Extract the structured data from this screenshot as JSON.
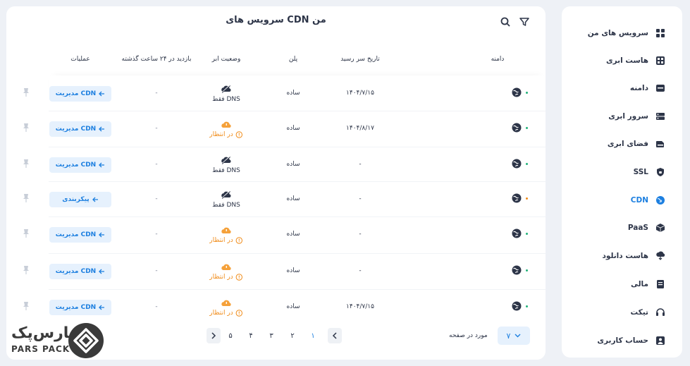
{
  "sidebar": {
    "items": [
      {
        "label": "سرویس های من",
        "icon": "grid-icon",
        "active": false
      },
      {
        "label": "هاست ابری",
        "icon": "host-icon",
        "active": false
      },
      {
        "label": "دامنه",
        "icon": "domain-icon",
        "active": false
      },
      {
        "label": "سرور ابری",
        "icon": "server-icon",
        "active": false
      },
      {
        "label": "فضای ابری",
        "icon": "storage-icon",
        "active": false
      },
      {
        "label": "SSL",
        "icon": "shield-icon",
        "active": false
      },
      {
        "label": "CDN",
        "icon": "globe-icon",
        "active": true
      },
      {
        "label": "PaaS",
        "icon": "box-icon",
        "active": false
      },
      {
        "label": "هاست دانلود",
        "icon": "cloud-download-icon",
        "active": false
      },
      {
        "label": "مالی",
        "icon": "invoice-icon",
        "active": false
      },
      {
        "label": "تیکت",
        "icon": "headset-icon",
        "active": false
      },
      {
        "label": "حساب کاربری",
        "icon": "user-icon",
        "active": false
      }
    ]
  },
  "main": {
    "title": "سرویس های CDN من",
    "columns": {
      "domain": "دامنه",
      "expiry": "تاریخ سر رسید",
      "plan": "پلن",
      "cloud_status": "وضعیت ابر",
      "visits": "بازدید در ۲۴ ساعت گذشته",
      "actions": "عملیات"
    },
    "rows": [
      {
        "expiry": "۱۴۰۴/۷/۱۵",
        "plan": "ساده",
        "status_type": "dns",
        "status": "فقط DNS",
        "visits": "-",
        "action": "مدیریت CDN",
        "dot": "green"
      },
      {
        "expiry": "۱۴۰۴/۸/۱۷",
        "plan": "ساده",
        "status_type": "wait",
        "status": "در انتظار",
        "visits": "-",
        "action": "مدیریت CDN",
        "dot": "green"
      },
      {
        "expiry": "-",
        "plan": "ساده",
        "status_type": "dns",
        "status": "فقط DNS",
        "visits": "-",
        "action": "مدیریت CDN",
        "dot": "green"
      },
      {
        "expiry": "-",
        "plan": "ساده",
        "status_type": "dns",
        "status": "فقط DNS",
        "visits": "-",
        "action": "پیکربندی",
        "dot": "orange"
      },
      {
        "expiry": "-",
        "plan": "ساده",
        "status_type": "wait",
        "status": "در انتظار",
        "visits": "-",
        "action": "مدیریت CDN",
        "dot": "green"
      },
      {
        "expiry": "-",
        "plan": "ساده",
        "status_type": "wait",
        "status": "در انتظار",
        "visits": "-",
        "action": "مدیریت CDN",
        "dot": "green"
      },
      {
        "expiry": "۱۴۰۴/۷/۱۵",
        "plan": "ساده",
        "status_type": "wait",
        "status": "در انتظار",
        "visits": "-",
        "action": "مدیریت CDN",
        "dot": "green"
      }
    ]
  },
  "pagination": {
    "pages": [
      "۱",
      "۲",
      "۳",
      "۴",
      "۵"
    ],
    "current": "۱",
    "per_page_label": "مورد در صفحه",
    "per_page_value": "۷"
  },
  "logo": {
    "fa": "پارس‌پک",
    "en": "PARS PACK"
  },
  "colors": {
    "accent": "#1c7fe0",
    "warning": "#f08c1a",
    "success": "#23b27a"
  }
}
